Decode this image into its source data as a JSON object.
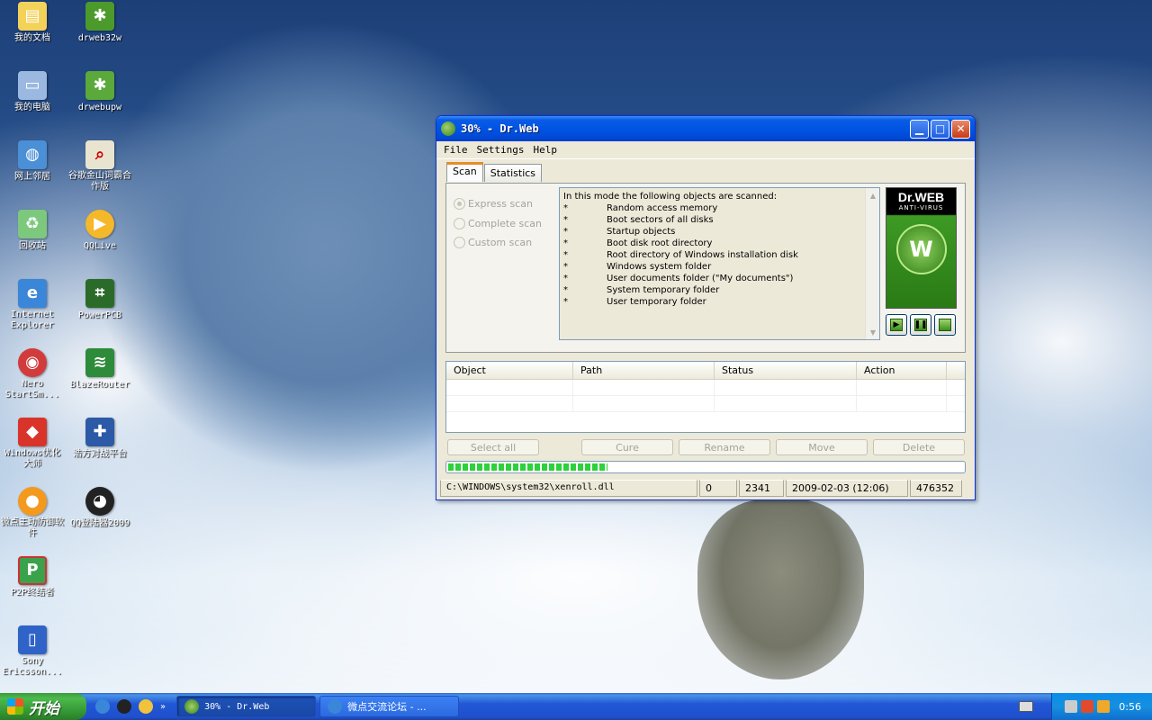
{
  "desktop": {
    "icons": [
      {
        "label": "我的文档"
      },
      {
        "label": "drweb32w"
      },
      {
        "label": "我的电脑"
      },
      {
        "label": "drwebupw"
      },
      {
        "label": "网上邻居"
      },
      {
        "label": "谷歌金山词霸合作版"
      },
      {
        "label": "回收站"
      },
      {
        "label": "QQLive"
      },
      {
        "label": "Internet Explorer"
      },
      {
        "label": "PowerPCB"
      },
      {
        "label": "Nero StartSm..."
      },
      {
        "label": "BlazeRouter"
      },
      {
        "label": "Windows优化大师"
      },
      {
        "label": "浩方对战平台"
      },
      {
        "label": "微点主动防御软件"
      },
      {
        "label": "QQ登陆器2009"
      },
      {
        "label": "P2P终结者"
      },
      {
        "label": "Sony Ericsson..."
      }
    ]
  },
  "window": {
    "title": "30% - Dr.Web",
    "menu": [
      "File",
      "Settings",
      "Help"
    ],
    "tabs": [
      "Scan",
      "Statistics"
    ],
    "scan_modes": [
      "Express scan",
      "Complete scan",
      "Custom scan"
    ],
    "description_header": "In this mode the following objects are scanned:",
    "description_items": [
      "Random access memory",
      "Boot sectors of all disks",
      "Startup objects",
      "Boot disk root directory",
      "Root directory of Windows installation disk",
      "Windows system folder",
      "User documents folder (\"My documents\")",
      "System temporary folder",
      "User temporary folder"
    ],
    "logo": {
      "brand": "Dr.WEB",
      "sub": "ANTI-VIRUS"
    },
    "table_headers": [
      "Object",
      "Path",
      "Status",
      "Action"
    ],
    "buttons": {
      "select_all": "Select all",
      "cure": "Cure",
      "rename": "Rename",
      "move": "Move",
      "delete": "Delete"
    },
    "progress_fraction": 0.31,
    "status": {
      "file": "C:\\WINDOWS\\system32\\xenroll.dll",
      "infected": "0",
      "scanned": "2341",
      "date": "2009-02-03 (12:06)",
      "count": "476352"
    }
  },
  "taskbar": {
    "start_label": "开始",
    "tasks": [
      {
        "label": "30% - Dr.Web"
      },
      {
        "label": "微点交流论坛 - ..."
      }
    ],
    "clock": "0:56"
  }
}
